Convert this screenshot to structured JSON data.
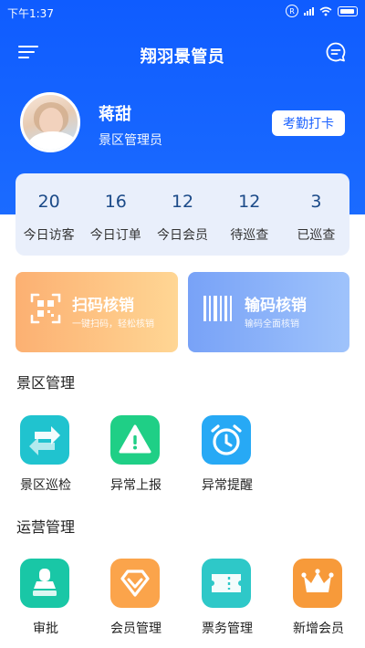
{
  "status_bar": {
    "time": "下午1:37",
    "badge_letter": "R"
  },
  "header": {
    "title": "翔羽景管员"
  },
  "profile": {
    "name": "蒋甜",
    "role": "景区管理员",
    "checkin_label": "考勤打卡"
  },
  "stats": [
    {
      "value": "20",
      "label": "今日访客"
    },
    {
      "value": "16",
      "label": "今日订单"
    },
    {
      "value": "12",
      "label": "今日会员"
    },
    {
      "value": "12",
      "label": "待巡查"
    },
    {
      "value": "3",
      "label": "已巡查"
    }
  ],
  "cards": {
    "scan": {
      "title": "扫码核销",
      "subtitle": "一键扫码，轻松核销",
      "icon": "qr-scan-icon"
    },
    "code": {
      "title": "输码核销",
      "subtitle": "输码全面核销",
      "icon": "barcode-icon"
    }
  },
  "sections": {
    "scenic": {
      "title": "景区管理",
      "items": [
        {
          "label": "景区巡检",
          "icon": "swap-arrows-icon",
          "color": "#20c3cf"
        },
        {
          "label": "异常上报",
          "icon": "warning-icon",
          "color": "#1fcf86"
        },
        {
          "label": "异常提醒",
          "icon": "alarm-clock-icon",
          "color": "#27a9f5"
        }
      ]
    },
    "ops": {
      "title": "运营管理",
      "items": [
        {
          "label": "审批",
          "icon": "stamp-icon",
          "color": "#19c7a6"
        },
        {
          "label": "会员管理",
          "icon": "diamond-icon",
          "color": "#fba44b"
        },
        {
          "label": "票务管理",
          "icon": "ticket-icon",
          "color": "#2ec8c8"
        },
        {
          "label": "新增会员",
          "icon": "crown-icon",
          "color": "#f79a3a"
        }
      ]
    }
  },
  "colors": {
    "primary": "#1b62ff",
    "stat_number": "#1b4a88"
  }
}
